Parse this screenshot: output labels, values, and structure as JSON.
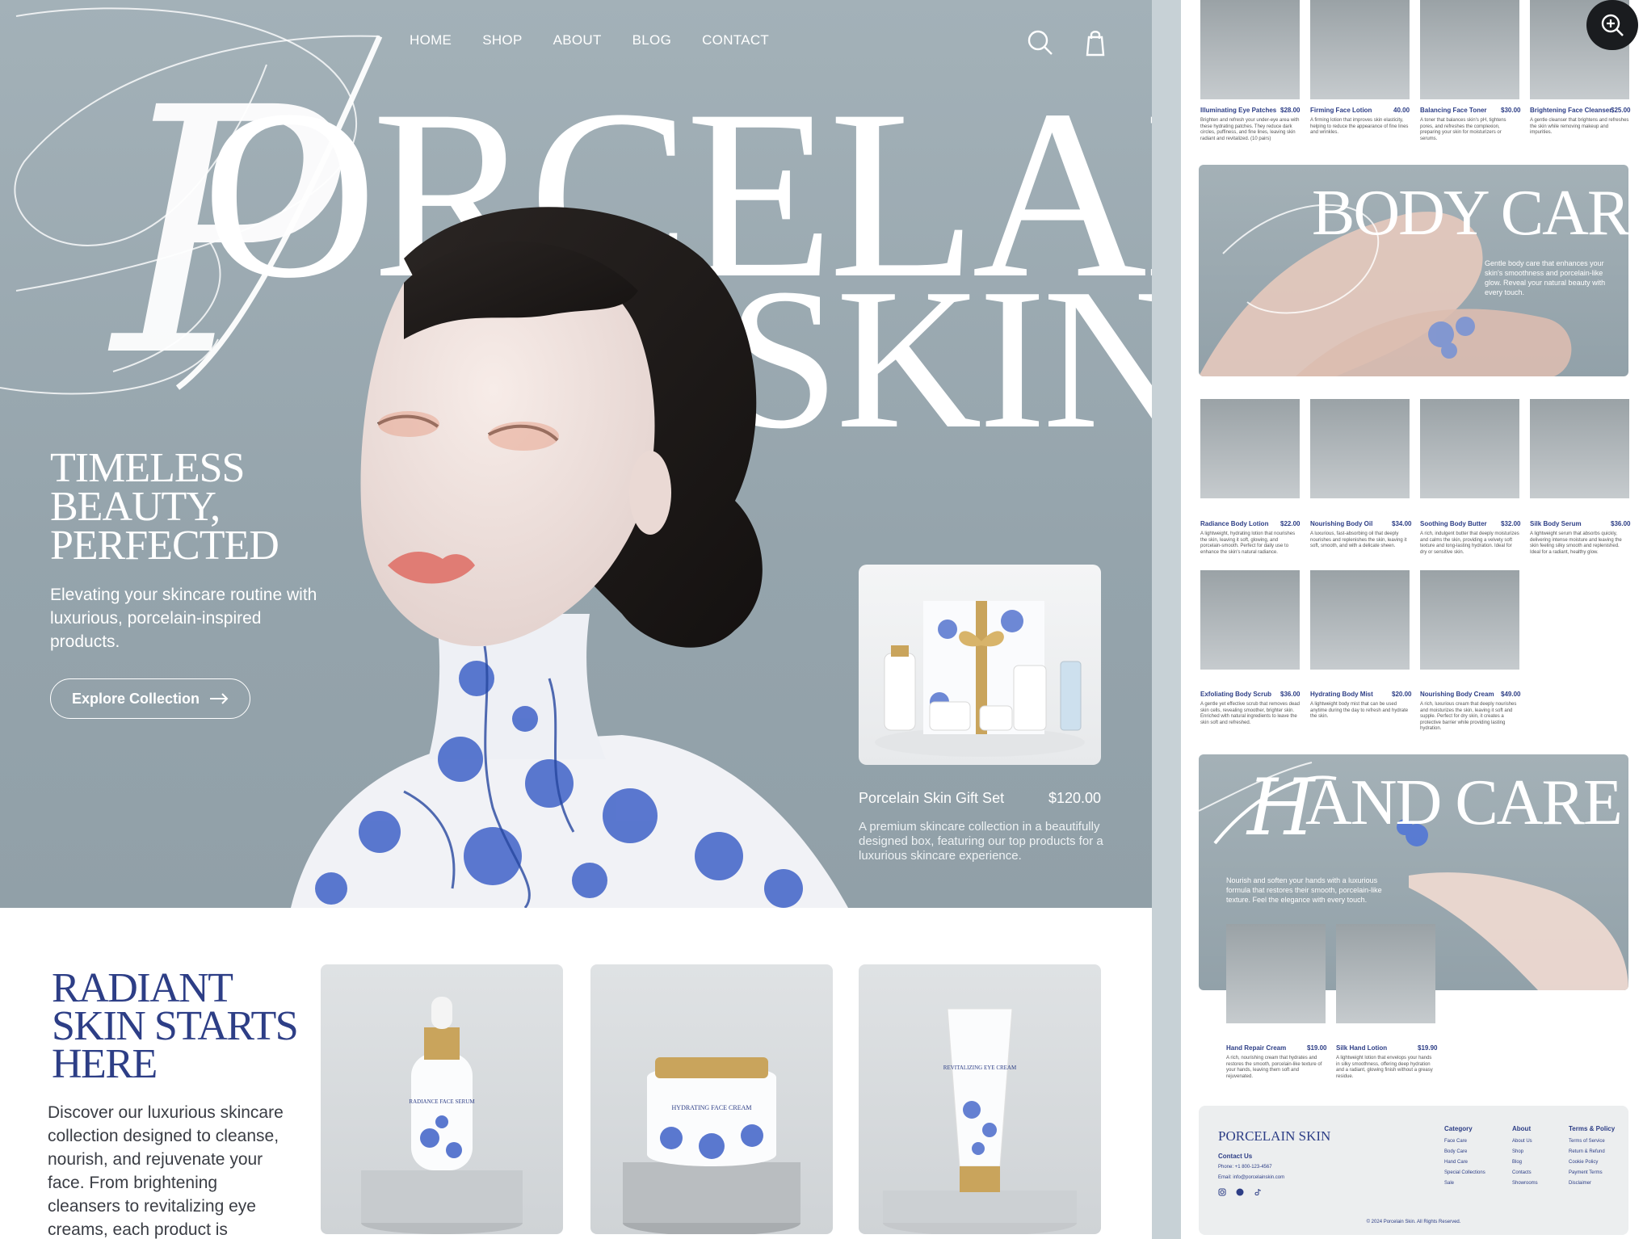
{
  "nav": {
    "items": [
      "HOME",
      "SHOP",
      "ABOUT",
      "BLOG",
      "CONTACT"
    ]
  },
  "hero": {
    "brand_line1": "ORCELAIN",
    "brand_letter": "P",
    "brand_line2": "SKIN",
    "title": "TIMELESS\nBEAUTY,\nPERFECTED",
    "subtitle": "Elevating your skincare routine with luxurious, porcelain-inspired products.",
    "cta": "Explore Collection"
  },
  "gift": {
    "name": "Porcelain Skin Gift Set",
    "price": "$120.00",
    "description": "A premium skincare collection in a beautifully designed box, featuring our top products for a luxurious skincare experience."
  },
  "radiant": {
    "title": "RADIANT\nSKIN STARTS\nHERE",
    "text": "Discover our luxurious skincare collection designed to cleanse, nourish, and rejuvenate your face. From brightening cleansers to revitalizing eye creams, each product is"
  },
  "featured_products": [
    {
      "label": "RADIANCE FACE SERUM"
    },
    {
      "label": "HYDRATING FACE CREAM"
    },
    {
      "label": "REVITALIZING EYE CREAM"
    }
  ],
  "face_products": [
    {
      "name": "Illuminating Eye Patches",
      "price": "$28.00",
      "desc": "Brighten and refresh your under-eye area with these hydrating patches. They reduce dark circles, puffiness, and fine lines, leaving skin radiant and revitalized. (10 pairs)"
    },
    {
      "name": "Firming Face Lotion",
      "price": "40.00",
      "desc": "A firming lotion that improves skin elasticity, helping to reduce the appearance of fine lines and wrinkles."
    },
    {
      "name": "Balancing Face Toner",
      "price": "$30.00",
      "desc": "A toner that balances skin's pH, tightens pores, and refreshes the complexion, preparing your skin for moisturizers or serums."
    },
    {
      "name": "Brightening Face Cleanser",
      "price": "$25.00",
      "desc": "A gentle cleanser that brightens and refreshes the skin while removing makeup and impurities."
    }
  ],
  "body_care": {
    "title": "BODY CARE",
    "text": "Gentle body care that enhances your skin's smoothness and porcelain-like glow. Reveal your natural beauty with every touch."
  },
  "body_products": [
    {
      "name": "Radiance Body Lotion",
      "price": "$22.00",
      "desc": "A lightweight, hydrating lotion that nourishes the skin, leaving it soft, glowing, and porcelain-smooth. Perfect for daily use to enhance the skin's natural radiance."
    },
    {
      "name": "Nourishing Body Oil",
      "price": "$34.00",
      "desc": "A luxurious, fast-absorbing oil that deeply nourishes and replenishes the skin, leaving it soft, smooth, and with a delicate sheen."
    },
    {
      "name": "Soothing Body Butter",
      "price": "$32.00",
      "desc": "A rich, indulgent butter that deeply moisturizes and calms the skin, providing a velvety soft texture and long-lasting hydration. Ideal for dry or sensitive skin."
    },
    {
      "name": "Silk Body Serum",
      "price": "$36.00",
      "desc": "A lightweight serum that absorbs quickly, delivering intense moisture and leaving the skin feeling silky smooth and replenished. Ideal for a radiant, healthy glow."
    },
    {
      "name": "Exfoliating Body Scrub",
      "price": "$36.00",
      "desc": "A gentle yet effective scrub that removes dead skin cells, revealing smoother, brighter skin. Enriched with natural ingredients to leave the skin soft and refreshed."
    },
    {
      "name": "Hydrating Body Mist",
      "price": "$20.00",
      "desc": "A lightweight body mist that can be used anytime during the day to refresh and hydrate the skin."
    },
    {
      "name": "Nourishing Body Cream",
      "price": "$49.00",
      "desc": "A rich, luxurious cream that deeply nourishes and moisturizes the skin, leaving it soft and supple. Perfect for dry skin, it creates a protective barrier while providing lasting hydration."
    }
  ],
  "hand_care": {
    "title": "AND CARE",
    "letter": "H",
    "text": "Nourish and soften your hands with a luxurious formula that restores their smooth, porcelain-like texture. Feel the elegance with every touch."
  },
  "hand_products": [
    {
      "name": "Hand Repair Cream",
      "price": "$19.00",
      "desc": "A rich, nourishing cream that hydrates and restores the smooth, porcelain-like texture of your hands, leaving them soft and rejuvenated."
    },
    {
      "name": "Silk Hand Lotion",
      "price": "$19.90",
      "desc": "A lightweight lotion that envelops your hands in silky smoothness, offering deep hydration and a radiant, glowing finish without a greasy residue."
    }
  ],
  "footer": {
    "brand": "PORCELAIN SKIN",
    "contact_heading": "Contact Us",
    "phone": "Phone: +1 800-123-4567",
    "email": "Email: info@porcelainskin.com",
    "columns": [
      {
        "heading": "Category",
        "items": [
          "Face Care",
          "Body Care",
          "Hand Care",
          "Special Collections",
          "Sale"
        ]
      },
      {
        "heading": "About",
        "items": [
          "About Us",
          "Shop",
          "Blog",
          "Contacts",
          "Showrooms"
        ]
      },
      {
        "heading": "Terms & Policy",
        "items": [
          "Terms of Service",
          "Return & Refund",
          "Cookie Policy",
          "Payment Terms",
          "Disclaimer"
        ]
      }
    ],
    "copyright": "© 2024 Porcelain Skin. All Rights Reserved."
  },
  "colors": {
    "hero_bg": "#95a4ac",
    "accent_navy": "#2d3e86",
    "porcelain_blue": "#3f62c8"
  }
}
